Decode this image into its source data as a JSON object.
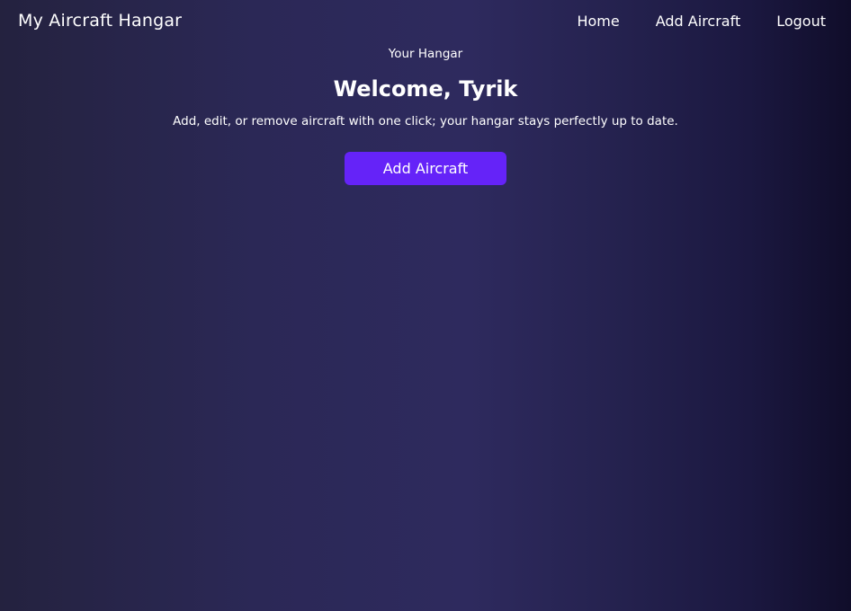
{
  "navbar": {
    "brand": "My Aircraft Hangar",
    "links": [
      {
        "label": "Home"
      },
      {
        "label": "Add Aircraft"
      },
      {
        "label": "Logout"
      }
    ]
  },
  "hero": {
    "eyebrow": "Your Hangar",
    "welcome": "Welcome, Tyrik",
    "subtitle": "Add, edit, or remove aircraft with one click; your hangar stays perfectly up to date.",
    "cta_label": "Add Aircraft"
  },
  "colors": {
    "accent": "#6523f8",
    "background_dark": "#100d2a",
    "background_mid": "#2e2a5e",
    "text": "#ffffff"
  }
}
